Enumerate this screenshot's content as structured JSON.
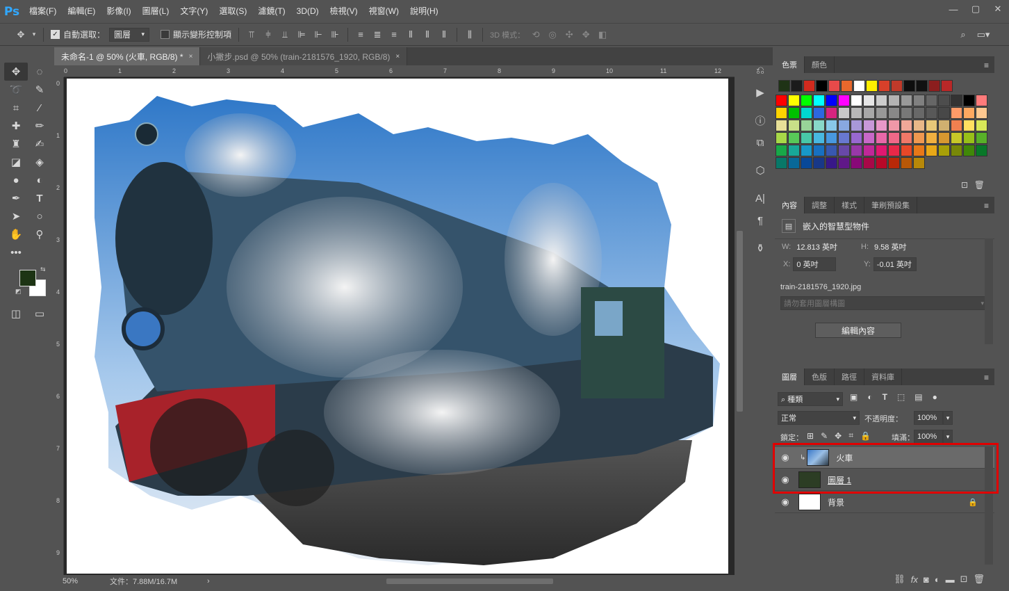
{
  "app": {
    "logo": "Ps"
  },
  "menu": [
    "檔案(F)",
    "編輯(E)",
    "影像(I)",
    "圖層(L)",
    "文字(Y)",
    "選取(S)",
    "濾鏡(T)",
    "3D(D)",
    "檢視(V)",
    "視窗(W)",
    "說明(H)"
  ],
  "window_controls": {
    "minimize": "—",
    "restore": "▢",
    "close": "✕"
  },
  "options": {
    "auto_select_label": "自動選取：",
    "auto_select_checked": "✓",
    "auto_select_value": "圖層",
    "transform_label": "顯示變形控制項",
    "mode_3d_label": "3D 模式："
  },
  "tabs": [
    {
      "label": "未命名-1 @ 50% (火車, RGB/8) *",
      "close": "×"
    },
    {
      "label": "小撇步.psd @ 50% (train-2181576_1920, RGB/8)",
      "close": "×"
    }
  ],
  "ruler": {
    "h": [
      "0",
      "1",
      "2",
      "3",
      "4",
      "5",
      "6",
      "7",
      "8",
      "9",
      "10",
      "11",
      "12"
    ],
    "v": [
      "0",
      "1",
      "2",
      "3",
      "4",
      "5",
      "6",
      "7",
      "8",
      "9"
    ]
  },
  "status": {
    "zoom": "50%",
    "doc": "文件：7.88M/16.7M",
    "arrow": "›"
  },
  "swatches_panel": {
    "tabs": [
      "色票",
      "顏色"
    ],
    "recent": [
      "#1f3316",
      "#1b1b1b",
      "#d12a1e",
      "#000000",
      "#e84a4a",
      "#e8682c",
      "#ffffff",
      "#ffee00",
      "#d8402a",
      "#c03a2a",
      "#0e0e0e",
      "#111111",
      "#8c1e1e",
      "#b82828"
    ],
    "grid": [
      "#ff0000",
      "#ffff00",
      "#00ff00",
      "#00ffff",
      "#0000ff",
      "#ff00ff",
      "#ffffff",
      "#e6e6e6",
      "#cccccc",
      "#b3b3b3",
      "#999999",
      "#808080",
      "#666666",
      "#4d4d4d",
      "#333333",
      "#000000",
      "#ff7b7b",
      "#ffd400",
      "#00c000",
      "#00d8d0",
      "#2d67e0",
      "#d6247f",
      "#c8c8c8",
      "#b8b8b8",
      "#a8a8a8",
      "#989898",
      "#888888",
      "#787878",
      "#686868",
      "#585858",
      "#484848",
      "#ff9b68",
      "#ffa860",
      "#ffc890",
      "#e8e098",
      "#c8e088",
      "#98d498",
      "#88d8c8",
      "#88c8e8",
      "#88a8e0",
      "#a898d8",
      "#c898d8",
      "#e898c8",
      "#f098a8",
      "#f0a898",
      "#e8b888",
      "#e8c878",
      "#d0b070",
      "#f08050",
      "#ffe060",
      "#d8e858",
      "#a8d848",
      "#58c858",
      "#48c8a8",
      "#48b8e0",
      "#4898e0",
      "#6878d0",
      "#9868d0",
      "#c868c8",
      "#e868a8",
      "#f06888",
      "#f07868",
      "#f09850",
      "#f0b040",
      "#d89830",
      "#c8c828",
      "#98c018",
      "#58b028",
      "#18a848",
      "#18a898",
      "#1898c8",
      "#1870c0",
      "#3858b0",
      "#6848a8",
      "#9838a8",
      "#c02898",
      "#e01870",
      "#e82848",
      "#e84828",
      "#e87818",
      "#e8a818",
      "#a8a008",
      "#788808",
      "#408808",
      "#087828",
      "#087868",
      "#086898",
      "#084898",
      "#183888",
      "#381888",
      "#601888",
      "#880878",
      "#a80848",
      "#b80828",
      "#b82808",
      "#b85808",
      "#b88808"
    ]
  },
  "props_panel": {
    "tabs": [
      "內容",
      "調整",
      "樣式",
      "筆刷預設集"
    ],
    "type": "嵌入的智慧型物件",
    "w_label": "W:",
    "w": "12.813 英吋",
    "h_label": "H:",
    "h": "9.58 英吋",
    "x_label": "X:",
    "x": "0 英吋",
    "y_label": "Y:",
    "y": "-0.01 英吋",
    "filename": "train-2181576_1920.jpg",
    "comp_placeholder": "請勿套用圖層構圖",
    "edit_btn": "編輯內容"
  },
  "layers_panel": {
    "tabs": [
      "圖層",
      "色版",
      "路徑",
      "資料庫"
    ],
    "filter": "種類",
    "blend": "正常",
    "opacity_label": "不透明度：",
    "opacity": "100%",
    "lock_label": "鎖定：",
    "fill_label": "填滿：",
    "fill": "100%",
    "layers": [
      {
        "name": "火車",
        "visible": true,
        "selected": true
      },
      {
        "name": "圖層 1",
        "visible": true,
        "selected": false
      },
      {
        "name": "背景",
        "visible": true,
        "selected": false
      }
    ]
  }
}
